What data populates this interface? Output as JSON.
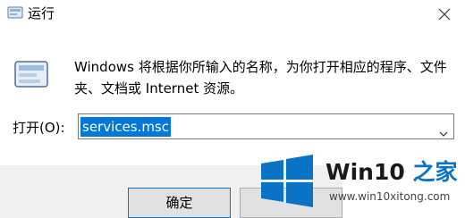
{
  "window": {
    "title": "运行",
    "close_icon": "close-icon"
  },
  "description": "Windows 将根据你所输入的名称，为你打开相应的程序、文件夹、文档或 Internet 资源。",
  "open": {
    "label": "打开(O):",
    "value": "services.msc"
  },
  "buttons": {
    "ok": "确定",
    "cancel": ""
  },
  "watermark": {
    "title_prefix": "Win10",
    "title_suffix": " 之家",
    "url": "www.win10xitong.com"
  },
  "colors": {
    "accent": "#0078d7",
    "logo_blue": "#0a73c5"
  }
}
